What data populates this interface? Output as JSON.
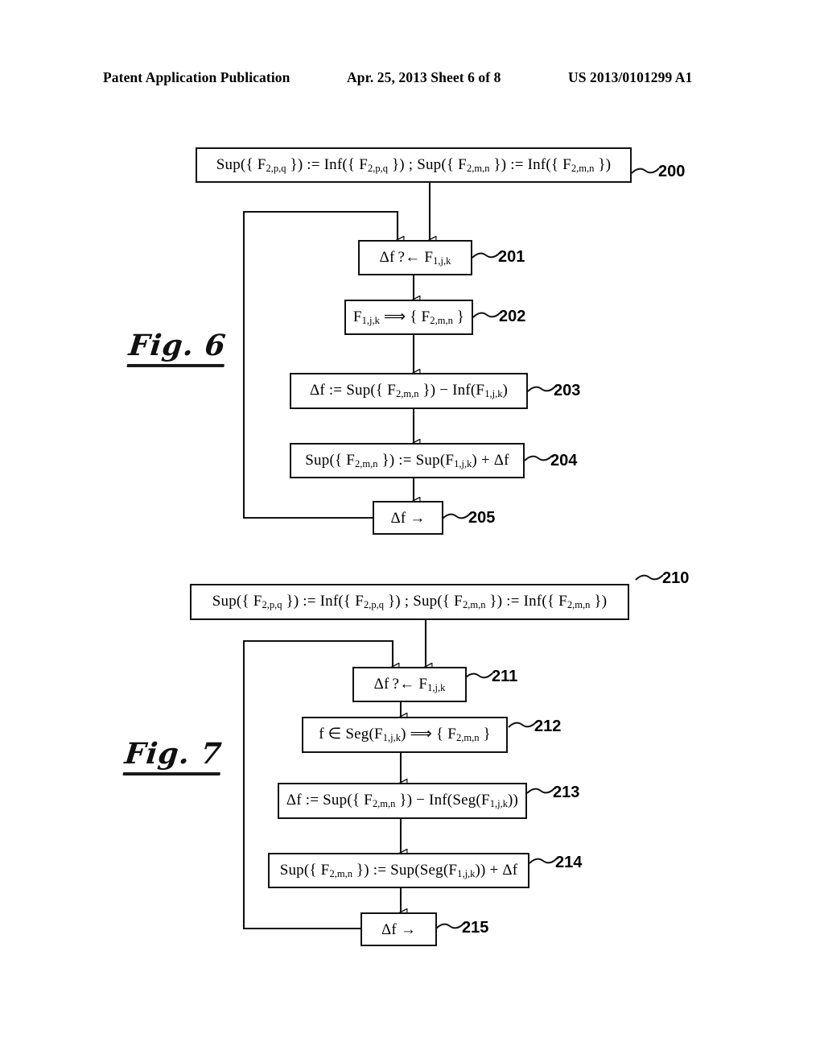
{
  "header": {
    "left": "Patent Application Publication",
    "middle": "Apr. 25, 2013  Sheet 6 of 8",
    "right": "US 2013/0101299 A1"
  },
  "figures": [
    {
      "id": "figure-6",
      "caption": "Fig. 6",
      "nodes": [
        {
          "ref": "200",
          "text": "Sup({ F2,p,q }) := Inf({ F2,p,q }) ; Sup({ F2,m,n }) := Inf({ F2,m,n })"
        },
        {
          "ref": "201",
          "text": "Δf ?← F1,j,k"
        },
        {
          "ref": "202",
          "text": "F1,j,k ⟹ { F2,m,n }"
        },
        {
          "ref": "203",
          "text": "Δf := Sup({ F2,m,n }) − Inf(F1,j,k)"
        },
        {
          "ref": "204",
          "text": "Sup({ F2,m,n }) := Sup(F1,j,k) + Δf"
        },
        {
          "ref": "205",
          "text": "Δf →"
        }
      ]
    },
    {
      "id": "figure-7",
      "caption": "Fig. 7",
      "nodes": [
        {
          "ref": "210",
          "text": "Sup({ F2,p,q }) := Inf({ F2,p,q }) ; Sup({ F2,m,n }) := Inf({ F2,m,n })"
        },
        {
          "ref": "211",
          "text": "Δf ?← F1,j,k"
        },
        {
          "ref": "212",
          "text": "f ∈ Seg(F1,j,k) ⟹ { F2,m,n }"
        },
        {
          "ref": "213",
          "text": "Δf := Sup({ F2,m,n }) − Inf(Seg(F1,j,k))"
        },
        {
          "ref": "214",
          "text": "Sup({ F2,m,n }) := Sup(Seg(F1,j,k)) + Δf"
        },
        {
          "ref": "215",
          "text": "Δf →"
        }
      ]
    }
  ],
  "colors": {
    "ink": "#111111",
    "paper": "#ffffff"
  }
}
